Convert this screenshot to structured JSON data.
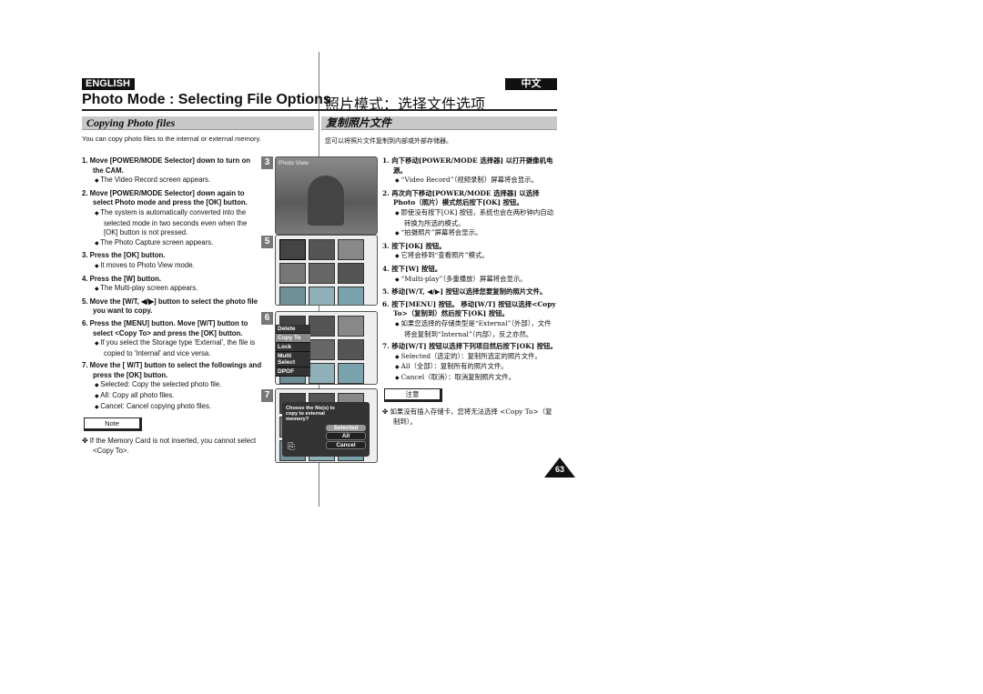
{
  "header": {
    "english_badge": "ENGLISH",
    "chinese_badge": "中文",
    "title_en": "Photo Mode : Selecting File Options",
    "title_zh": "照片模式：选择文件选项"
  },
  "section": {
    "en": "Copying Photo files",
    "zh": "复制照片文件"
  },
  "intro": {
    "en": "You can copy photo files to the internal or external memory.",
    "zh": "您可以将照片文件复制到内部或外部存储器。"
  },
  "steps_en": [
    {
      "h": "1. Move [POWER/MODE Selector] down to turn on the CAM.",
      "subs": [
        "The Video Record screen appears."
      ]
    },
    {
      "h": "2. Move [POWER/MODE Selector] down again to select Photo mode and press the [OK] button.",
      "subs": [
        "The system is automatically converted into the selected mode in two seconds even when the [OK] button is not pressed.",
        "The Photo Capture screen appears."
      ]
    },
    {
      "h": "3. Press the [OK] button.",
      "subs": [
        "It moves to Photo View mode."
      ]
    },
    {
      "h": "4. Press the [W] button.",
      "subs": [
        "The Multi-play screen appears."
      ]
    },
    {
      "h": "5. Move the [W/T, ◀/▶] button to select the photo file you want to copy.",
      "subs": []
    },
    {
      "h": "6. Press the [MENU] button. Move [W/T] button to select <Copy To> and press the [OK] button.",
      "subs": [
        "If you select the Storage type 'External', the file is copied to 'Internal' and vice versa."
      ]
    },
    {
      "h": "7. Move the [ W/T] button to select the followings and press the [OK] button.",
      "subs": [
        "Selected: Copy the selected photo file.",
        "All: Copy all photo files.",
        "Cancel: Cancel copying photo files."
      ]
    }
  ],
  "steps_zh": [
    {
      "h": "1. 向下移动[POWER/MODE 选择器] 以打开摄像机电源。",
      "subs": [
        "“Video Record”（视频录制）屏幕将会显示。"
      ]
    },
    {
      "h": "2. 再次向下移动[POWER/MODE 选择器] 以选择 Photo（照片）模式然后按下[OK] 按钮。",
      "subs": [
        "即使没有按下[OK] 按钮，系统也会在两秒钟内自动转换为所选的模式。",
        "“拍摄照片”屏幕将会显示。"
      ]
    },
    {
      "h": "3. 按下[OK] 按钮。",
      "subs": [
        "它将会移到“查看照片”模式。"
      ]
    },
    {
      "h": "4. 按下[W] 按钮。",
      "subs": [
        "“Multi-play”（多重播放）屏幕将会显示。"
      ]
    },
    {
      "h": "5. 移动[W/T, ◀/▶] 按钮以选择您要复制的照片文件。",
      "subs": []
    },
    {
      "h": "6. 按下[MENU] 按钮。 移动[W/T] 按钮以选择<Copy To>（复制到）然后按下[OK] 按钮。",
      "subs": [
        "如果您选择的存储类型是“External”（外部），文件将会复制到“Internal”（内部），反之亦然。"
      ]
    },
    {
      "h": "7. 移动[W/T] 按钮以选择下列项目然后按下[OK] 按钮。",
      "subs": [
        "Selected（选定的）：复制所选定的照片文件。",
        "All（全部）：复制所有的照片文件。",
        "Cancel（取消）：取消复制照片文件。"
      ]
    }
  ],
  "note": {
    "label_en": "Note",
    "text_en": "✤ If the Memory Card is not inserted, you cannot select <Copy To>.",
    "label_zh": "注意",
    "text_zh": "✤ 如果没有插入存储卡，您将无法选择 <Copy To>（复制到）。"
  },
  "screens": {
    "s3": {
      "num": "3",
      "label": "Photo View"
    },
    "s5": {
      "num": "5"
    },
    "s6": {
      "num": "6",
      "menu": [
        "Delete",
        "Copy To",
        "Lock",
        "Multi Select",
        "DPOF"
      ]
    },
    "s7": {
      "num": "7",
      "question": "Choose the file(s) to copy to external memory?",
      "options": [
        "Selected",
        "All",
        "Cancel"
      ]
    }
  },
  "page_number": "63"
}
